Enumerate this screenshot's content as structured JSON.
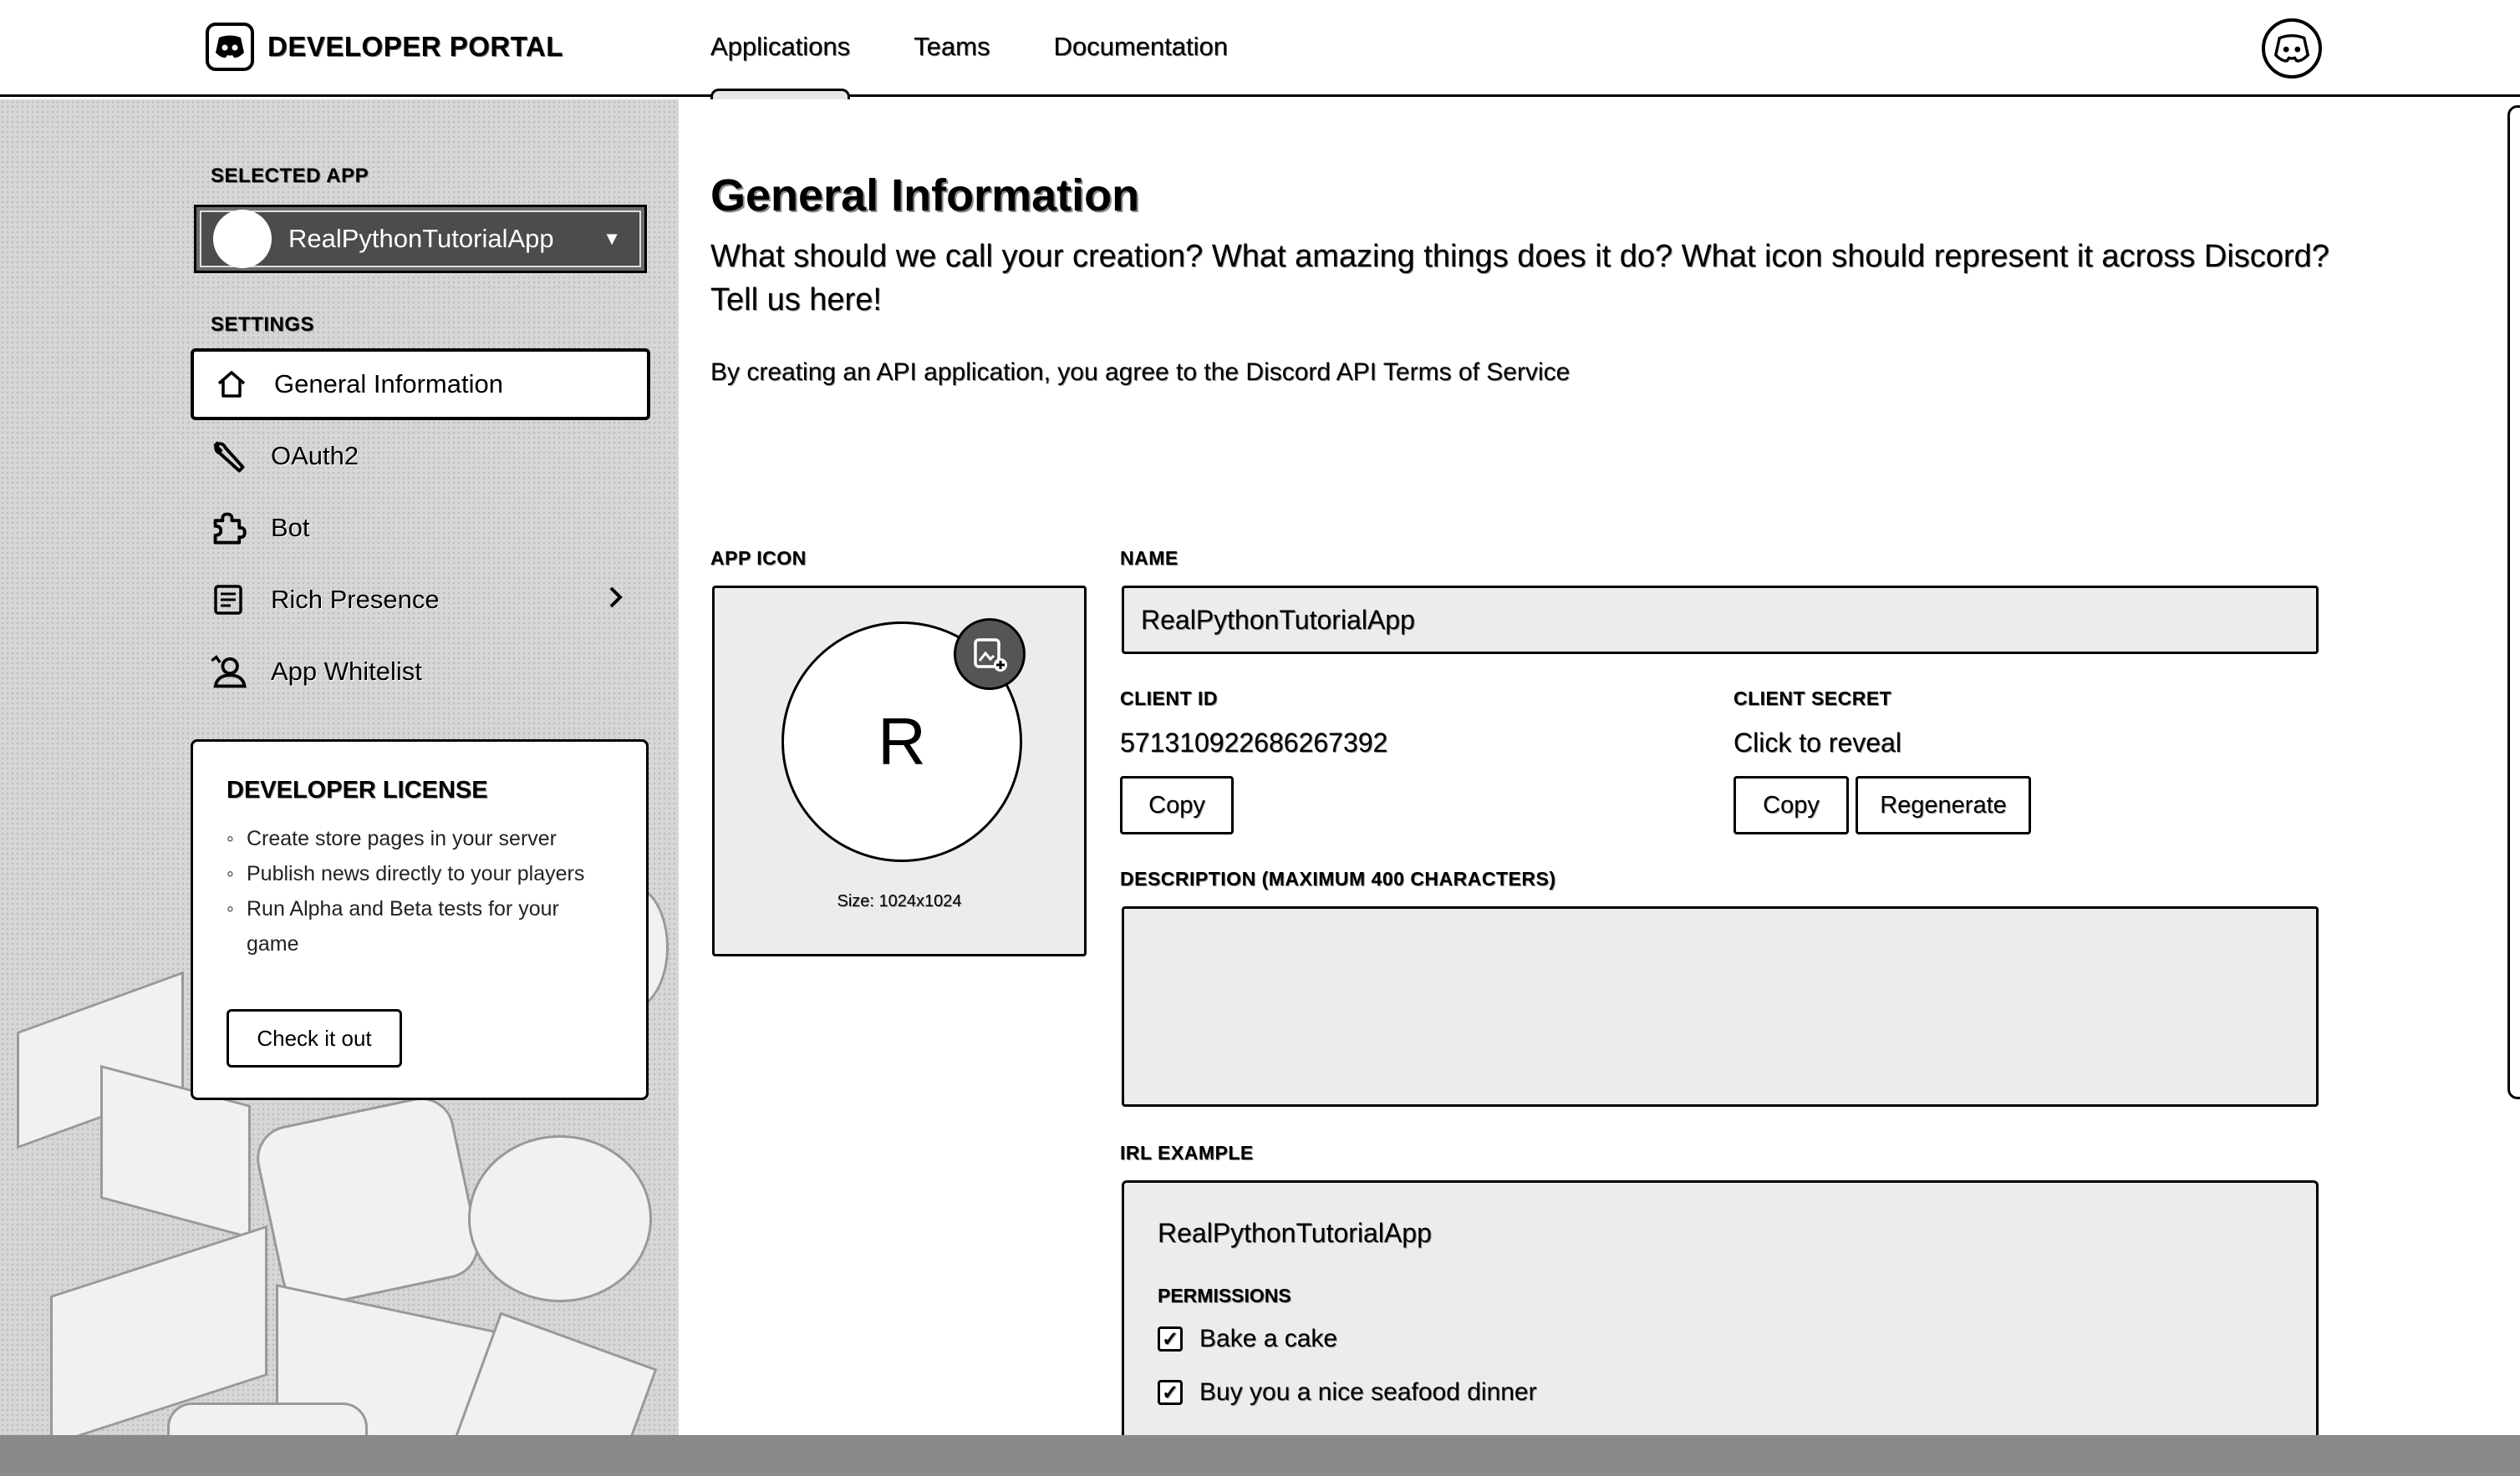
{
  "header": {
    "brand": "DEVELOPER PORTAL",
    "nav": [
      {
        "label": "Applications",
        "active": true
      },
      {
        "label": "Teams",
        "active": false
      },
      {
        "label": "Documentation",
        "active": false
      }
    ],
    "avatar_icon": "discord-avatar-icon"
  },
  "sidebar": {
    "selected_app_label": "SELECTED APP",
    "selected_app": "RealPythonTutorialApp",
    "settings_label": "SETTINGS",
    "items": [
      {
        "label": "General Information",
        "icon": "home-icon",
        "active": true
      },
      {
        "label": "OAuth2",
        "icon": "wrench-icon",
        "active": false
      },
      {
        "label": "Bot",
        "icon": "puzzle-icon",
        "active": false
      },
      {
        "label": "Rich Presence",
        "icon": "document-icon",
        "active": false
      },
      {
        "label": "App Whitelist",
        "icon": "person-icon",
        "active": false
      }
    ],
    "license": {
      "title": "DEVELOPER LICENSE",
      "bullets": [
        "Create store pages in your server",
        "Publish news directly to your players",
        "Run Alpha and Beta tests for your game"
      ],
      "button": "Check it out"
    }
  },
  "main": {
    "title": "General Information",
    "subtitle": "What should we call your creation? What amazing things does it do? What icon should represent it across Discord? Tell us here!",
    "terms": "By creating an API application, you agree to the Discord API Terms of Service",
    "app_icon_label": "APP ICON",
    "app_icon_letter": "R",
    "app_icon_size": "Size: 1024x1024",
    "name_label": "NAME",
    "name_value": "RealPythonTutorialApp",
    "client_id_label": "CLIENT ID",
    "client_id": "571310922686267392",
    "client_secret_label": "CLIENT SECRET",
    "client_secret": "Click to reveal",
    "copy_label": "Copy",
    "regenerate_label": "Regenerate",
    "description_label": "DESCRIPTION (MAXIMUM 400 CHARACTERS)",
    "description_value": "",
    "irl_label": "IRL EXAMPLE",
    "example": {
      "app_name": "RealPythonTutorialApp",
      "permissions_label": "PERMISSIONS",
      "permissions": [
        "Bake a cake",
        "Buy you a nice seafood dinner"
      ]
    }
  }
}
